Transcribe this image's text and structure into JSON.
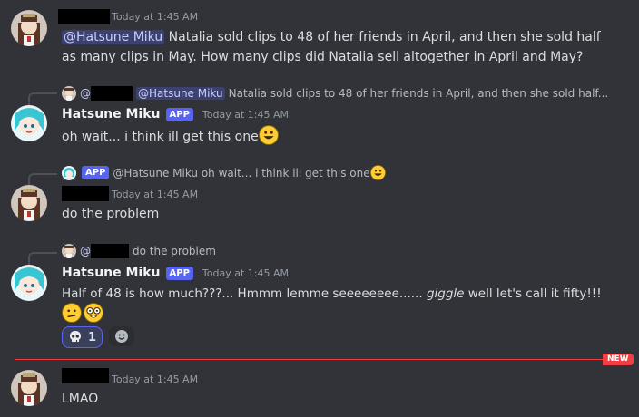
{
  "messages": {
    "m1": {
      "timestamp": "Today at 1:45 AM",
      "mention": "@Hatsune Miku",
      "text_line1": " Natalia sold clips to 48 of her friends in April, and then she sold half",
      "text_line2": "as many clips in May. How many clips did Natalia sell altogether in April and May?"
    },
    "m2": {
      "reply_prefix": "@",
      "reply_mention": "@Hatsune Miku",
      "reply_text": "Natalia sold clips to 48 of her friends in April, and then she sold half...",
      "username": "Hatsune Miku",
      "badge": "APP",
      "timestamp": "Today at 1:45 AM",
      "text": "oh wait... i think ill get this one"
    },
    "m3": {
      "reply_badge": "APP",
      "reply_text": "@Hatsune Miku oh wait... i think ill get this one",
      "timestamp": "Today at 1:45 AM",
      "text": "do the problem"
    },
    "m4": {
      "reply_prefix": "@",
      "reply_text": "do the problem",
      "username": "Hatsune Miku",
      "badge": "APP",
      "timestamp": "Today at 1:45 AM",
      "text_a": "Half of 48 is how much???... Hmmm lemme seeeeeeee...... ",
      "text_italic": "giggle",
      "text_b": " well let's call it fifty!!!",
      "reaction_count": "1"
    },
    "divider": {
      "label": "NEW"
    },
    "m5": {
      "timestamp": "Today at 1:45 AM",
      "text": "LMAO"
    }
  },
  "icons": [
    "kancolle-avatar",
    "miku-avatar",
    "grinning-emoji",
    "confused-emoji",
    "nerd-emoji",
    "skull-emoji",
    "add-reaction-icon"
  ],
  "colors": {
    "background": "#313338",
    "mention_bg": "#3c4270",
    "app_badge": "#5865f2",
    "new_divider": "#f23f43"
  }
}
